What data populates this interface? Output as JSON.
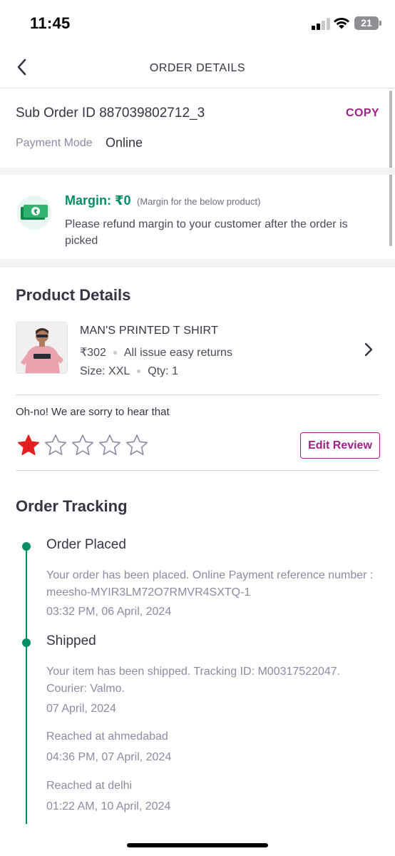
{
  "status_bar": {
    "time": "11:45",
    "battery": "21"
  },
  "header": {
    "title": "ORDER DETAILS",
    "back_icon": "chevron-left-icon"
  },
  "order": {
    "sub_order_label": "Sub Order ID 887039802712_3",
    "copy_label": "COPY",
    "payment_mode_label": "Payment Mode",
    "payment_mode_value": "Online"
  },
  "margin": {
    "icon": "cash-icon",
    "title": "Margin: ₹0",
    "note": "(Margin for the below product)",
    "description": "Please refund margin to your customer after the order is picked"
  },
  "product": {
    "section_title": "Product Details",
    "name": "MAN'S PRINTED T SHIRT",
    "price": "₹302",
    "returns": "All issue easy returns",
    "size": "Size: XXL",
    "qty": "Qty: 1"
  },
  "review": {
    "message": "Oh-no! We are sorry to hear that",
    "rating": 1,
    "max_rating": 5,
    "edit_label": "Edit Review",
    "colors": {
      "filled": "#e31e1e",
      "empty": "#8b8ba3"
    }
  },
  "tracking": {
    "section_title": "Order Tracking",
    "steps": [
      {
        "title": "Order Placed",
        "description": "Your order has been placed. Online Payment reference number : meesho-MYIR3LM72O7RMVR4SXTQ-1",
        "time": "03:32 PM, 06 April, 2024"
      },
      {
        "title": "Shipped",
        "description": "Your item has been shipped. Tracking ID: M00317522047. Courier: Valmo.",
        "time": "07 April, 2024",
        "updates": [
          {
            "location": "Reached at ahmedabad",
            "time": "04:36 PM, 07 April, 2024"
          },
          {
            "location": "Reached at delhi",
            "time": "01:22 AM, 10 April, 2024"
          }
        ]
      }
    ]
  },
  "colors": {
    "accent": "#9f2089",
    "success": "#038d63",
    "text": "#353543",
    "muted": "#8b8ba3"
  }
}
